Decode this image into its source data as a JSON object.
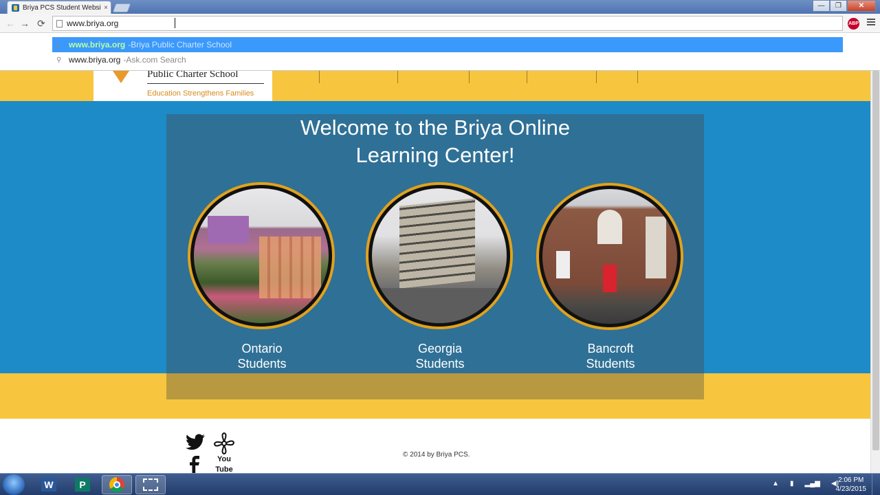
{
  "browser": {
    "tab_title": "Briya PCS Student Website",
    "tab_close": "×",
    "url": "www.briya.org",
    "extension_label": "ABP",
    "window_buttons": {
      "minimize": "—",
      "maximize": "❐",
      "close": "✕"
    }
  },
  "omnibox_dropdown": {
    "suggestions": [
      {
        "main": "www.briya.org",
        "separator": " - ",
        "desc": "Briya Public Charter School",
        "icon": "page-icon"
      },
      {
        "main": "www.briya.org",
        "separator": " - ",
        "desc": "Ask.com Search",
        "icon": "search-icon"
      }
    ]
  },
  "site": {
    "logo_name": "Public Charter School",
    "logo_tagline": "Education Strengthens Families",
    "welcome_line1": "Welcome to the Briya Online",
    "welcome_line2": "Learning Center!",
    "campuses": [
      {
        "line1": "Ontario",
        "line2": "Students"
      },
      {
        "line1": "Georgia",
        "line2": "Students"
      },
      {
        "line1": "Bancroft",
        "line2": "Students"
      }
    ],
    "footer": {
      "copyright": "© 2014 by Briya PCS.",
      "youtube_label": "You Tube"
    }
  },
  "taskbar": {
    "apps": [
      "W",
      "P"
    ],
    "clock_time": "2:06 PM",
    "clock_date": "4/23/2015"
  },
  "colors": {
    "brand_yellow": "#f7c63e",
    "brand_blue": "#1d8bc7",
    "circle_ring": "#e0a21d"
  }
}
